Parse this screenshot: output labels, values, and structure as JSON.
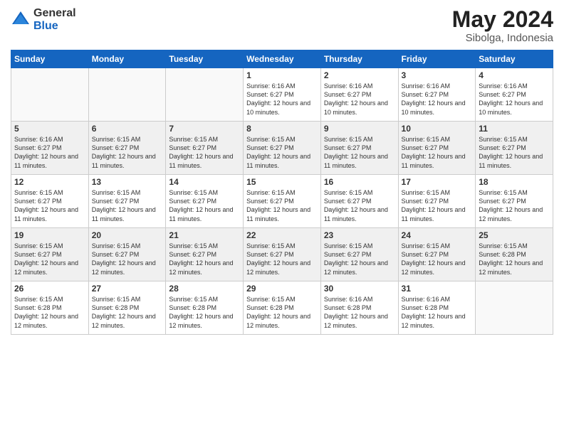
{
  "logo": {
    "general": "General",
    "blue": "Blue"
  },
  "title": "May 2024",
  "location": "Sibolga, Indonesia",
  "days_header": [
    "Sunday",
    "Monday",
    "Tuesday",
    "Wednesday",
    "Thursday",
    "Friday",
    "Saturday"
  ],
  "weeks": [
    {
      "shaded": false,
      "days": [
        {
          "num": "",
          "empty": true
        },
        {
          "num": "",
          "empty": true
        },
        {
          "num": "",
          "empty": true
        },
        {
          "num": "1",
          "info": "Sunrise: 6:16 AM\nSunset: 6:27 PM\nDaylight: 12 hours\nand 10 minutes."
        },
        {
          "num": "2",
          "info": "Sunrise: 6:16 AM\nSunset: 6:27 PM\nDaylight: 12 hours\nand 10 minutes."
        },
        {
          "num": "3",
          "info": "Sunrise: 6:16 AM\nSunset: 6:27 PM\nDaylight: 12 hours\nand 10 minutes."
        },
        {
          "num": "4",
          "info": "Sunrise: 6:16 AM\nSunset: 6:27 PM\nDaylight: 12 hours\nand 10 minutes."
        }
      ]
    },
    {
      "shaded": true,
      "days": [
        {
          "num": "5",
          "info": "Sunrise: 6:16 AM\nSunset: 6:27 PM\nDaylight: 12 hours\nand 11 minutes."
        },
        {
          "num": "6",
          "info": "Sunrise: 6:15 AM\nSunset: 6:27 PM\nDaylight: 12 hours\nand 11 minutes."
        },
        {
          "num": "7",
          "info": "Sunrise: 6:15 AM\nSunset: 6:27 PM\nDaylight: 12 hours\nand 11 minutes."
        },
        {
          "num": "8",
          "info": "Sunrise: 6:15 AM\nSunset: 6:27 PM\nDaylight: 12 hours\nand 11 minutes."
        },
        {
          "num": "9",
          "info": "Sunrise: 6:15 AM\nSunset: 6:27 PM\nDaylight: 12 hours\nand 11 minutes."
        },
        {
          "num": "10",
          "info": "Sunrise: 6:15 AM\nSunset: 6:27 PM\nDaylight: 12 hours\nand 11 minutes."
        },
        {
          "num": "11",
          "info": "Sunrise: 6:15 AM\nSunset: 6:27 PM\nDaylight: 12 hours\nand 11 minutes."
        }
      ]
    },
    {
      "shaded": false,
      "days": [
        {
          "num": "12",
          "info": "Sunrise: 6:15 AM\nSunset: 6:27 PM\nDaylight: 12 hours\nand 11 minutes."
        },
        {
          "num": "13",
          "info": "Sunrise: 6:15 AM\nSunset: 6:27 PM\nDaylight: 12 hours\nand 11 minutes."
        },
        {
          "num": "14",
          "info": "Sunrise: 6:15 AM\nSunset: 6:27 PM\nDaylight: 12 hours\nand 11 minutes."
        },
        {
          "num": "15",
          "info": "Sunrise: 6:15 AM\nSunset: 6:27 PM\nDaylight: 12 hours\nand 11 minutes."
        },
        {
          "num": "16",
          "info": "Sunrise: 6:15 AM\nSunset: 6:27 PM\nDaylight: 12 hours\nand 11 minutes."
        },
        {
          "num": "17",
          "info": "Sunrise: 6:15 AM\nSunset: 6:27 PM\nDaylight: 12 hours\nand 11 minutes."
        },
        {
          "num": "18",
          "info": "Sunrise: 6:15 AM\nSunset: 6:27 PM\nDaylight: 12 hours\nand 12 minutes."
        }
      ]
    },
    {
      "shaded": true,
      "days": [
        {
          "num": "19",
          "info": "Sunrise: 6:15 AM\nSunset: 6:27 PM\nDaylight: 12 hours\nand 12 minutes."
        },
        {
          "num": "20",
          "info": "Sunrise: 6:15 AM\nSunset: 6:27 PM\nDaylight: 12 hours\nand 12 minutes."
        },
        {
          "num": "21",
          "info": "Sunrise: 6:15 AM\nSunset: 6:27 PM\nDaylight: 12 hours\nand 12 minutes."
        },
        {
          "num": "22",
          "info": "Sunrise: 6:15 AM\nSunset: 6:27 PM\nDaylight: 12 hours\nand 12 minutes."
        },
        {
          "num": "23",
          "info": "Sunrise: 6:15 AM\nSunset: 6:27 PM\nDaylight: 12 hours\nand 12 minutes."
        },
        {
          "num": "24",
          "info": "Sunrise: 6:15 AM\nSunset: 6:27 PM\nDaylight: 12 hours\nand 12 minutes."
        },
        {
          "num": "25",
          "info": "Sunrise: 6:15 AM\nSunset: 6:28 PM\nDaylight: 12 hours\nand 12 minutes."
        }
      ]
    },
    {
      "shaded": false,
      "days": [
        {
          "num": "26",
          "info": "Sunrise: 6:15 AM\nSunset: 6:28 PM\nDaylight: 12 hours\nand 12 minutes."
        },
        {
          "num": "27",
          "info": "Sunrise: 6:15 AM\nSunset: 6:28 PM\nDaylight: 12 hours\nand 12 minutes."
        },
        {
          "num": "28",
          "info": "Sunrise: 6:15 AM\nSunset: 6:28 PM\nDaylight: 12 hours\nand 12 minutes."
        },
        {
          "num": "29",
          "info": "Sunrise: 6:15 AM\nSunset: 6:28 PM\nDaylight: 12 hours\nand 12 minutes."
        },
        {
          "num": "30",
          "info": "Sunrise: 6:16 AM\nSunset: 6:28 PM\nDaylight: 12 hours\nand 12 minutes."
        },
        {
          "num": "31",
          "info": "Sunrise: 6:16 AM\nSunset: 6:28 PM\nDaylight: 12 hours\nand 12 minutes."
        },
        {
          "num": "",
          "empty": true
        }
      ]
    }
  ]
}
